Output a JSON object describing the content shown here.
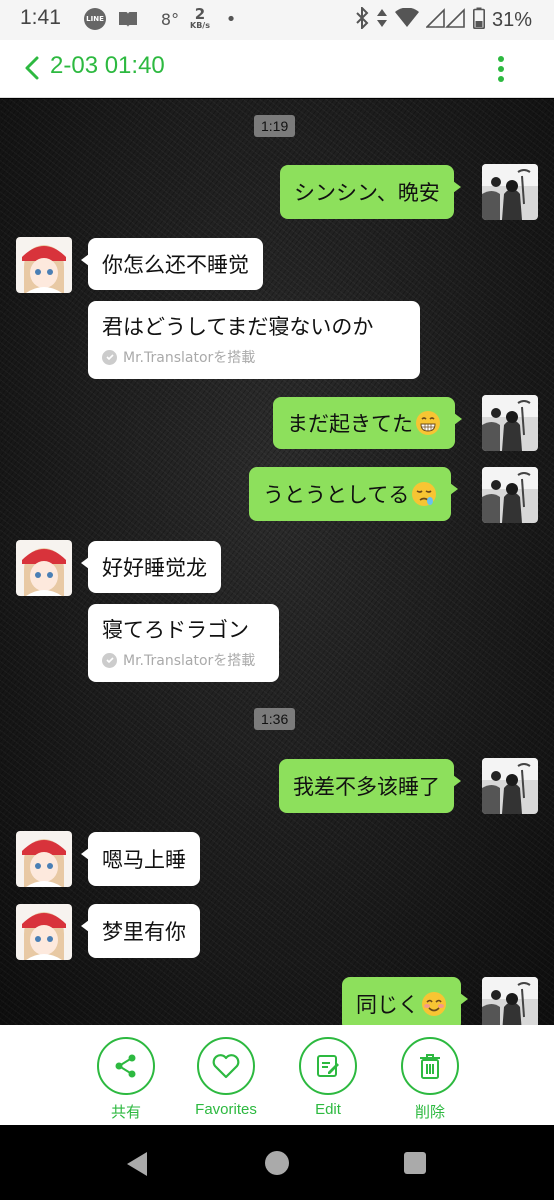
{
  "status_bar": {
    "time": "1:41",
    "line_badge": "LINE",
    "temperature": "8°",
    "net_speed_value": "2",
    "net_speed_unit": "KB/s",
    "dot": "•",
    "battery": "31%"
  },
  "header": {
    "title": "2-03 01:40",
    "accent_color": "#2db940"
  },
  "chat": {
    "timestamps": [
      "1:19",
      "1:36"
    ],
    "messages": [
      {
        "from": "me",
        "text": "シンシン、晩安"
      },
      {
        "from": "other",
        "text": "你怎么还不睡觉"
      },
      {
        "from": "other",
        "translation": "君はどうしてまだ寝ないのか",
        "note": "Mr.Translatorを搭載"
      },
      {
        "from": "me",
        "text": "まだ起きてた",
        "emoji": "grinning-face"
      },
      {
        "from": "me",
        "text": "うとうとしてる",
        "emoji": "sleepy-face"
      },
      {
        "from": "other",
        "text": "好好睡觉龙"
      },
      {
        "from": "other",
        "translation": "寝てろドラゴン",
        "note": "Mr.Translatorを搭載"
      },
      {
        "from": "me",
        "text": "我差不多该睡了"
      },
      {
        "from": "other",
        "text": "嗯马上睡"
      },
      {
        "from": "other",
        "text": "梦里有你"
      },
      {
        "from": "me",
        "text": "同じく",
        "emoji": "smiling-face"
      }
    ],
    "bubble_me_color": "#8de05c",
    "bubble_other_color": "#ffffff"
  },
  "actions": [
    {
      "label": "共有",
      "icon": "share-icon"
    },
    {
      "label": "Favorites",
      "icon": "heart-icon"
    },
    {
      "label": "Edit",
      "icon": "edit-icon"
    },
    {
      "label": "削除",
      "icon": "trash-icon"
    }
  ]
}
